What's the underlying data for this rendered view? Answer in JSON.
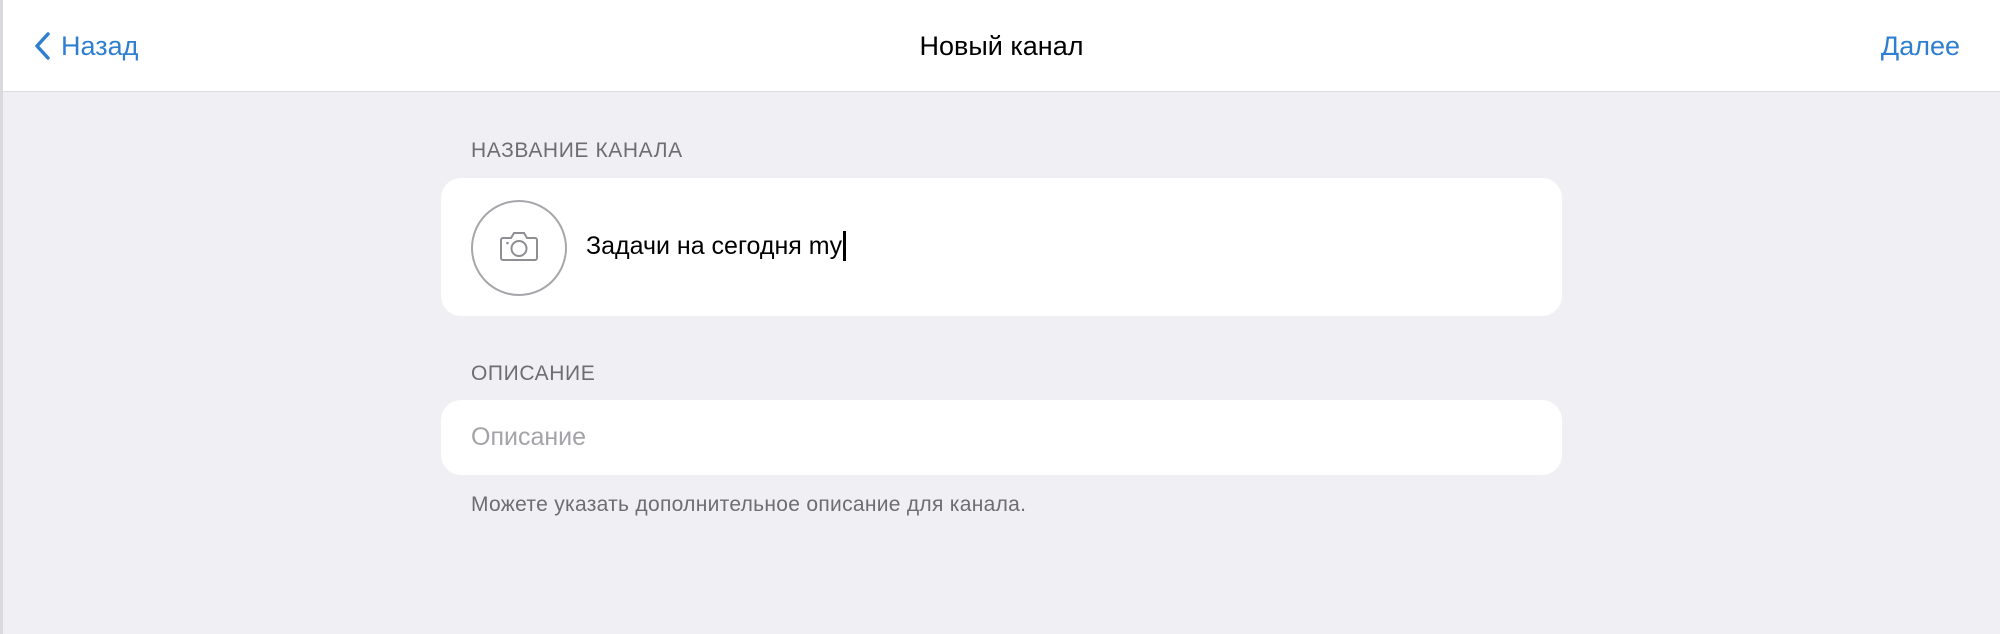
{
  "nav": {
    "back_label": "Назад",
    "title": "Новый канал",
    "next_label": "Далее"
  },
  "name_section": {
    "header": "НАЗВАНИЕ КАНАЛА",
    "camera_icon": "camera-icon",
    "name_value": "Задачи на сегодня my"
  },
  "description_section": {
    "header": "ОПИСАНИЕ",
    "placeholder": "Описание",
    "value": "",
    "footer": "Можете указать дополнительное описание для канала."
  },
  "colors": {
    "accent": "#2f7fd1",
    "background": "#efeff4",
    "card": "#ffffff",
    "secondary_text": "#6d6d72",
    "placeholder": "#a3a3a8"
  }
}
